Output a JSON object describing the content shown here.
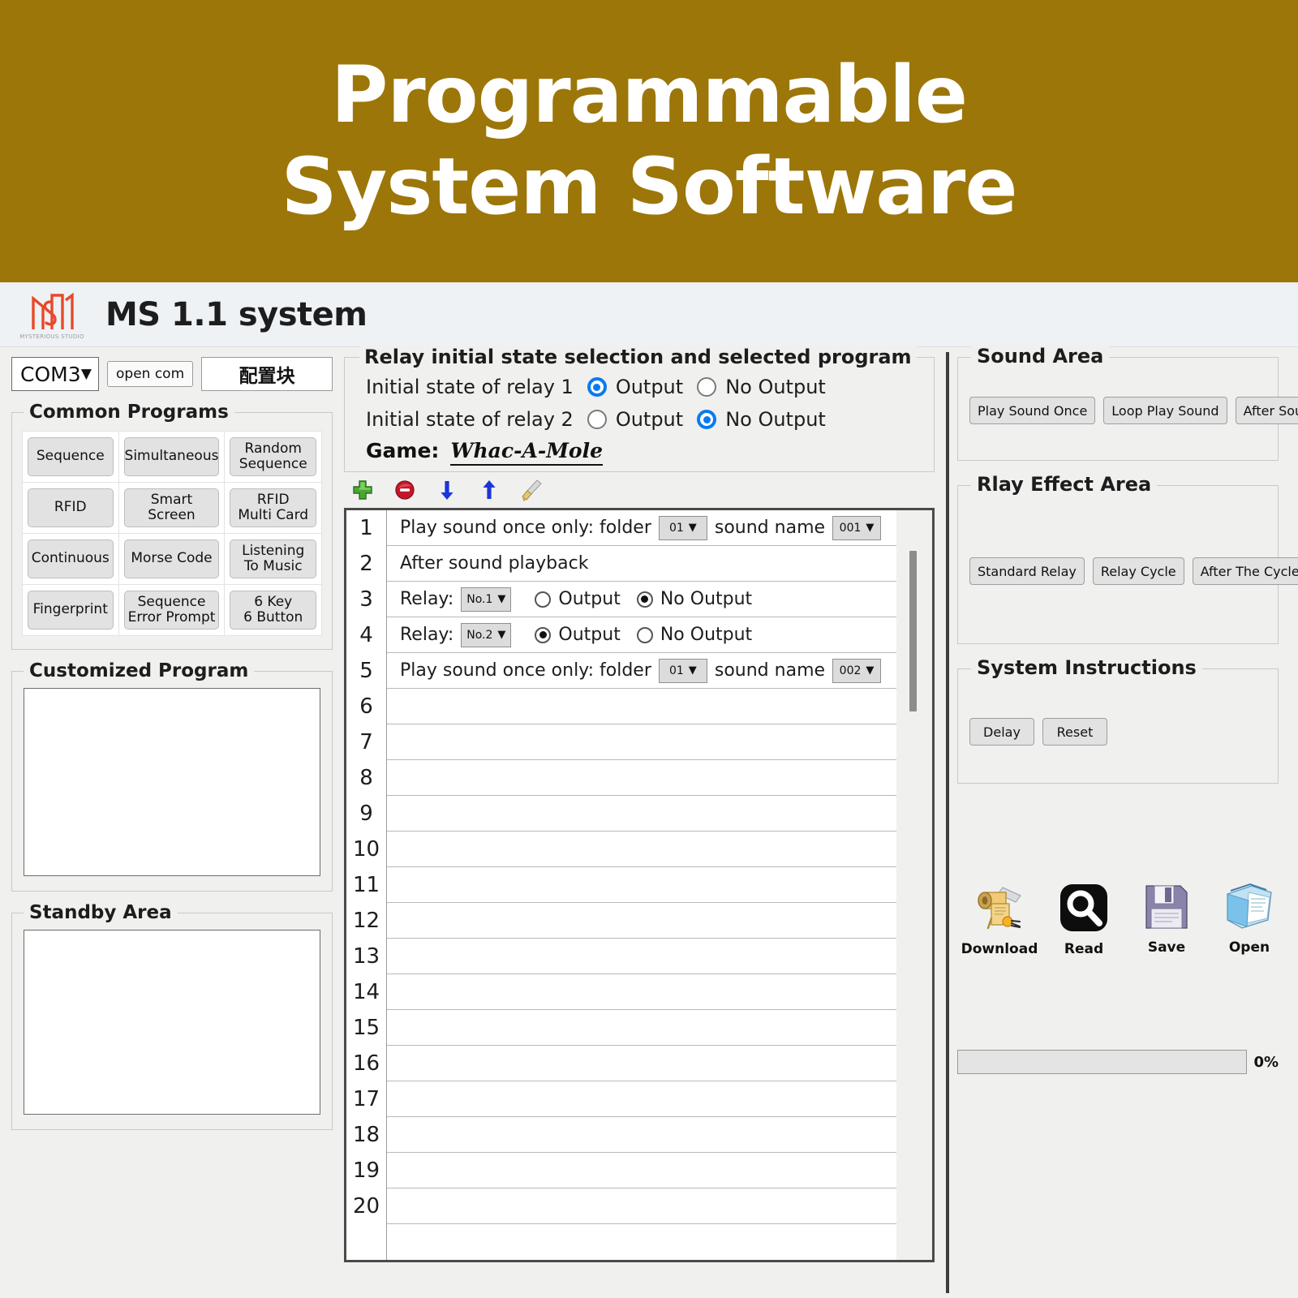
{
  "banner": {
    "line1": "Programmable",
    "line2": "System Software",
    "bg_color": "#9c7609"
  },
  "titlebar": {
    "logo_name": "ms-monogram-logo",
    "logo_caption": "MYSTERIOUS STUDIO",
    "title": "MS 1.1 system"
  },
  "connection": {
    "port_value": "COM3",
    "caret": "▼",
    "open_com_label": "open com",
    "config_label": "配置块"
  },
  "common_programs": {
    "legend": "Common Programs",
    "buttons": [
      "Sequence",
      "Simultaneous",
      "Random\nSequence",
      "RFID",
      "Smart\nScreen",
      "RFID\nMulti Card",
      "Continuous",
      "Morse Code",
      "Listening\nTo Music",
      "Fingerprint",
      "Sequence\nError Prompt",
      "6 Key\n6 Button"
    ]
  },
  "customized_program": {
    "legend": "Customized Program",
    "content": ""
  },
  "standby_area": {
    "legend": "Standby Area",
    "content": ""
  },
  "relay_panel": {
    "legend": "Relay initial state selection and selected program",
    "relay1": {
      "label": "Initial state of relay 1",
      "output_label": "Output",
      "no_output_label": "No Output",
      "selected": "output"
    },
    "relay2": {
      "label": "Initial state of relay 2",
      "output_label": "Output",
      "no_output_label": "No Output",
      "selected": "no_output"
    },
    "game_label": "Game:",
    "game_value": "Whac-A-Mole",
    "accent_color": "#0a7bf0"
  },
  "list_toolbar": {
    "icons": [
      "add-icon",
      "remove-icon",
      "move-down-icon",
      "move-up-icon",
      "clear-broom-icon"
    ]
  },
  "program_list": {
    "row_count": 20,
    "rows": [
      {
        "n": "1",
        "type": "play_sound",
        "prefix": "Play sound once only: folder",
        "folder": "01",
        "mid": "sound name",
        "sound": "001"
      },
      {
        "n": "2",
        "type": "text",
        "text": "After sound playback"
      },
      {
        "n": "3",
        "type": "relay",
        "label": "Relay:",
        "relay": "No.1",
        "output_label": "Output",
        "no_output_label": "No Output",
        "selected": "no_output"
      },
      {
        "n": "4",
        "type": "relay",
        "label": "Relay:",
        "relay": "No.2",
        "output_label": "Output",
        "no_output_label": "No Output",
        "selected": "output"
      },
      {
        "n": "5",
        "type": "play_sound",
        "prefix": "Play sound once only: folder",
        "folder": "01",
        "mid": "sound name",
        "sound": "002"
      },
      {
        "n": "6",
        "type": "blank"
      },
      {
        "n": "7",
        "type": "blank"
      },
      {
        "n": "8",
        "type": "blank"
      },
      {
        "n": "9",
        "type": "blank"
      },
      {
        "n": "10",
        "type": "blank"
      },
      {
        "n": "11",
        "type": "blank"
      },
      {
        "n": "12",
        "type": "blank"
      },
      {
        "n": "13",
        "type": "blank"
      },
      {
        "n": "14",
        "type": "blank"
      },
      {
        "n": "15",
        "type": "blank"
      },
      {
        "n": "16",
        "type": "blank"
      },
      {
        "n": "17",
        "type": "blank"
      },
      {
        "n": "18",
        "type": "blank"
      },
      {
        "n": "19",
        "type": "blank"
      },
      {
        "n": "20",
        "type": "blank"
      }
    ]
  },
  "sound_area": {
    "legend": "Sound Area",
    "buttons": [
      "Play Sound Once",
      "Loop Play Sound",
      "After Sound Play"
    ]
  },
  "relay_effect_area": {
    "legend": "Rlay Effect Area",
    "buttons": [
      "Standard Relay",
      "Relay Cycle",
      "After The Cycle Relay"
    ]
  },
  "system_instructions": {
    "legend": "System Instructions",
    "buttons": [
      "Delay",
      "Reset"
    ]
  },
  "actions": [
    {
      "icon": "scroll-download-icon",
      "label": "Download"
    },
    {
      "icon": "magnifier-read-icon",
      "label": "Read"
    },
    {
      "icon": "floppy-save-icon",
      "label": "Save"
    },
    {
      "icon": "folder-open-icon",
      "label": "Open"
    }
  ],
  "progress": {
    "percent_label": "0%",
    "value": 0
  }
}
